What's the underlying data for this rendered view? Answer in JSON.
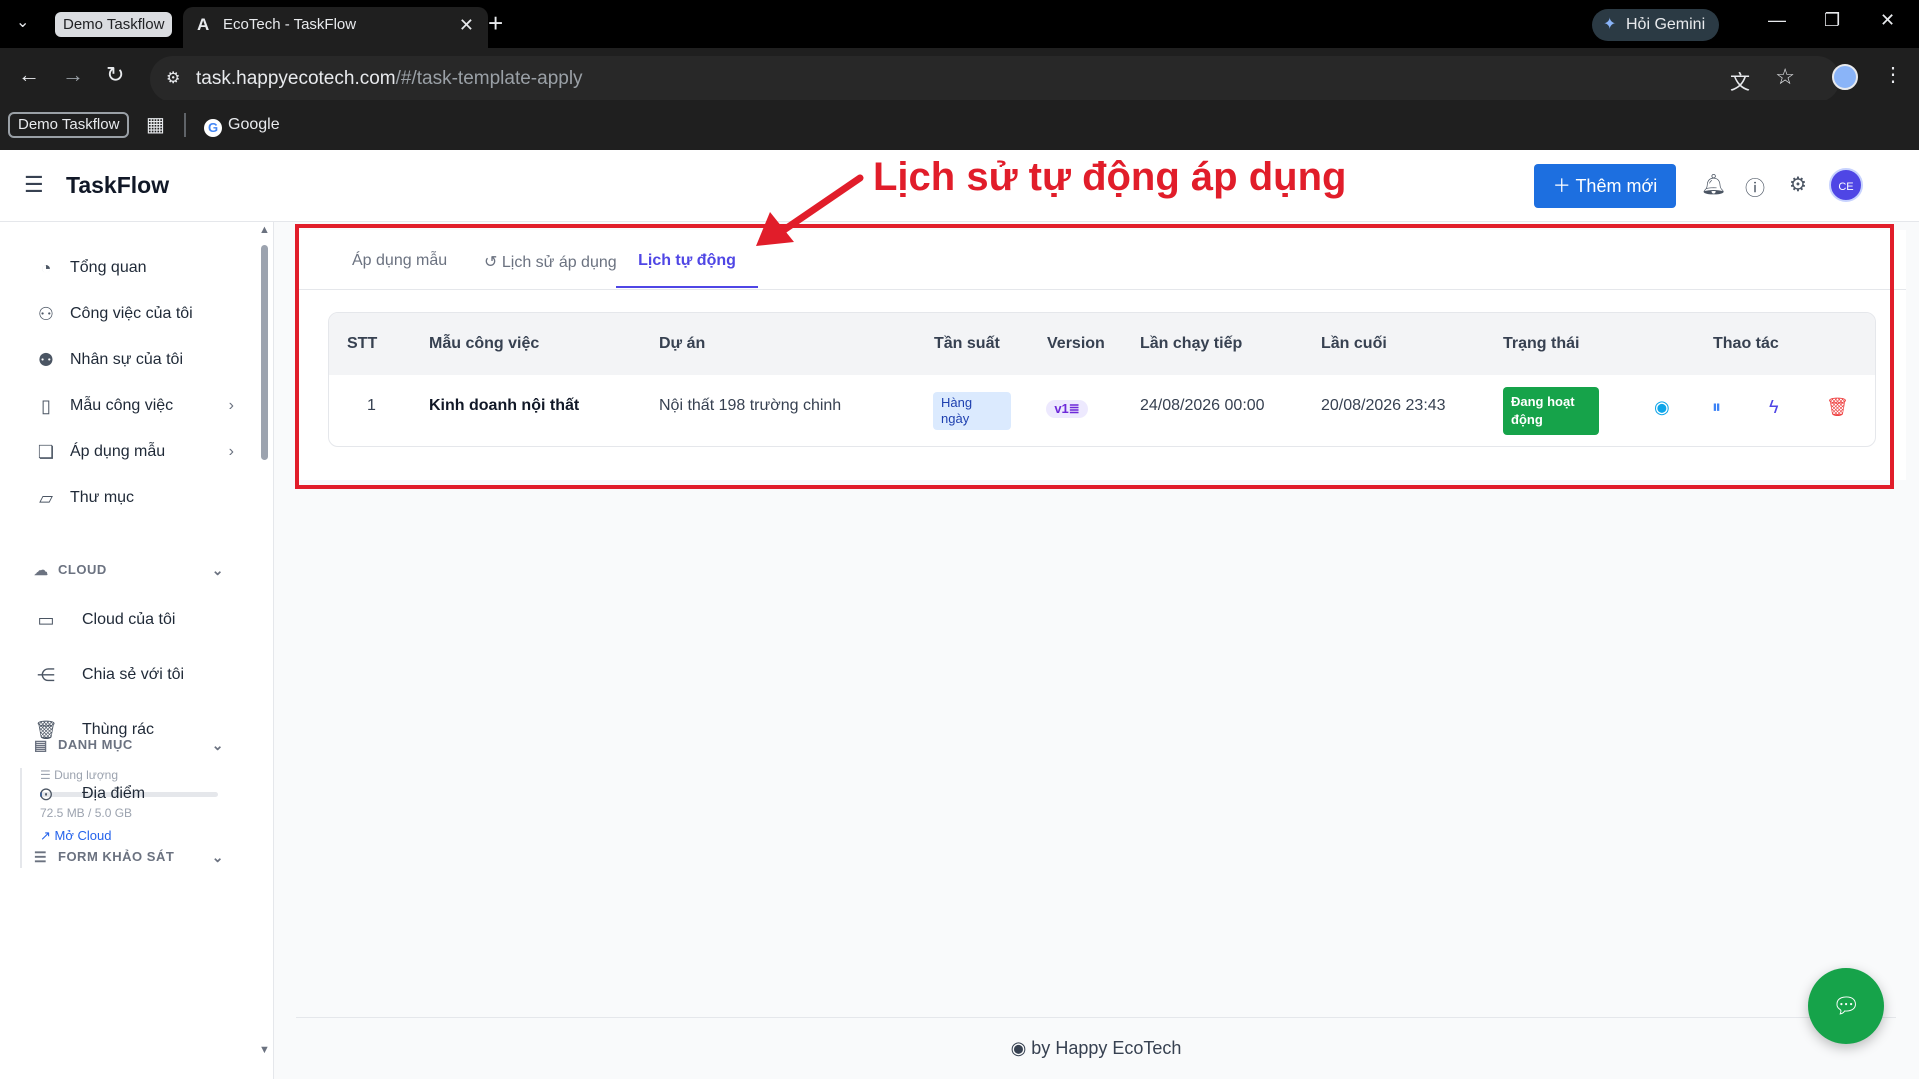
{
  "browser": {
    "tab_group": "Demo Taskflow",
    "active_tab_title": "EcoTech - TaskFlow",
    "gemini_label": "Hỏi Gemini",
    "url_host": "task.happyecotech.com",
    "url_path": "/#/task-template-apply",
    "bookmark_group": "Demo Taskflow",
    "bookmark_google": "Google"
  },
  "header": {
    "brand": "TaskFlow",
    "add_button": "Thêm mới",
    "avatar": "CE"
  },
  "annotation": {
    "text": "Lịch sử tự động áp dụng"
  },
  "sidebar": {
    "items": [
      {
        "label": "Tổng quan",
        "icon": "dashboard-icon"
      },
      {
        "label": "Công việc của tôi",
        "icon": "user-icon"
      },
      {
        "label": "Nhân sự của tôi",
        "icon": "users-icon"
      },
      {
        "label": "Mẫu công việc",
        "icon": "file-icon"
      },
      {
        "label": "Áp dụng mẫu",
        "icon": "copy-icon"
      },
      {
        "label": "Thư mục",
        "icon": "folder-open-icon"
      }
    ],
    "cloud_section": "CLOUD",
    "cloud_items": [
      {
        "label": "Cloud của tôi"
      },
      {
        "label": "Chia sẻ với tôi"
      },
      {
        "label": "Thùng rác"
      }
    ],
    "storage": {
      "label": "Dung lượng",
      "value": "72.5 MB / 5.0 GB",
      "fraction": 0.014,
      "open_link": "Mở Cloud"
    },
    "category_section": "DANH MỤC",
    "category_items": [
      {
        "label": "Địa điểm"
      }
    ],
    "survey_section": "FORM KHẢO SÁT"
  },
  "tabs": [
    {
      "label": "Áp dụng mẫu"
    },
    {
      "label": "Lịch sử áp dụng"
    },
    {
      "label": "Lịch tự động"
    }
  ],
  "table": {
    "headers": [
      "STT",
      "Mẫu công việc",
      "Dự án",
      "Tần suất",
      "Version",
      "Lần chạy tiếp",
      "Lần cuối",
      "Trạng thái",
      "Thao tác"
    ],
    "rows": [
      {
        "stt": "1",
        "template": "Kinh doanh nội thất",
        "project": "Nội thất 198 trường chinh",
        "frequency": "Hàng ngày",
        "version": "v1",
        "next_run": "24/08/2026 00:00",
        "last_run": "20/08/2026 23:43",
        "status": "Đang hoạt động"
      }
    ]
  },
  "footer": {
    "by": "by",
    "company": "Happy EcoTech"
  },
  "colors": {
    "primary": "#1d6fe0",
    "accent": "#4f46e5",
    "success": "#16a34a",
    "danger": "#e11d2a"
  }
}
